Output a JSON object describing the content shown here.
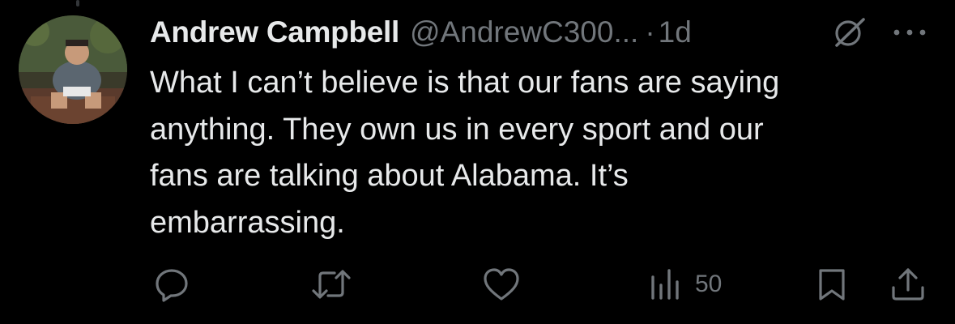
{
  "tweet": {
    "author_name": "Andrew Campbell",
    "author_handle": "@AndrewC300...",
    "separator": "·",
    "timestamp": "1d",
    "text_lines": [
      "What I can’t believe is that our fans are saying",
      "anything. They own us in every sport and our",
      "fans are talking about Alabama. It’s",
      "embarrassing."
    ]
  },
  "actions": {
    "reply_icon": "reply-icon",
    "retweet_icon": "retweet-icon",
    "like_icon": "like-icon",
    "views_icon": "views-icon",
    "views_count": "50",
    "bookmark_icon": "bookmark-icon",
    "share_icon": "share-icon"
  },
  "header_icons": {
    "grok_icon": "grok-icon",
    "more_icon": "more-icon"
  },
  "colors": {
    "background": "#000000",
    "primary_text": "#e7e9ea",
    "secondary_text": "#71767b"
  }
}
